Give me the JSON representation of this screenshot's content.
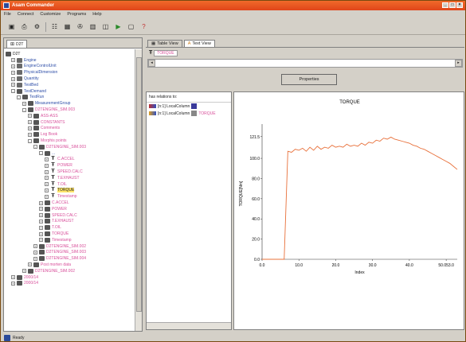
{
  "window": {
    "title": "Asam Commander"
  },
  "menu": [
    "File",
    "Connect",
    "Customize",
    "Programs",
    "Help"
  ],
  "toolbar": [
    "save-icon",
    "print-icon",
    "settings-icon",
    "tree-icon",
    "table-icon",
    "tools-icon",
    "book-icon",
    "window-icon",
    "play-icon",
    "page-icon",
    "help-icon"
  ],
  "left": {
    "tab_label": "D2T",
    "tree": [
      {
        "d": 0,
        "exp": "",
        "ico": "folder",
        "label": "D2T",
        "style": ""
      },
      {
        "d": 1,
        "exp": "+",
        "ico": "file",
        "label": "Engine",
        "style": "blue"
      },
      {
        "d": 1,
        "exp": "+",
        "ico": "file",
        "label": "EngineControlUnit",
        "style": "blue"
      },
      {
        "d": 1,
        "exp": "+",
        "ico": "file",
        "label": "PhysicalDimension",
        "style": "blue"
      },
      {
        "d": 1,
        "exp": "+",
        "ico": "file",
        "label": "Quantity",
        "style": "blue"
      },
      {
        "d": 1,
        "exp": "+",
        "ico": "file",
        "label": "TestBed",
        "style": "blue"
      },
      {
        "d": 1,
        "exp": "-",
        "ico": "folder",
        "label": "TestDemand",
        "style": "blue"
      },
      {
        "d": 2,
        "exp": "-",
        "ico": "folder",
        "label": "TestRun",
        "style": "blue"
      },
      {
        "d": 3,
        "exp": "+",
        "ico": "folder",
        "label": "MeasurementGroup",
        "style": "blue"
      },
      {
        "d": 3,
        "exp": "-",
        "ico": "folder",
        "label": "D2TENGINE_SIM.003",
        "style": "pink"
      },
      {
        "d": 4,
        "exp": "+",
        "ico": "folder",
        "label": "ASS-ASS",
        "style": "pink"
      },
      {
        "d": 4,
        "exp": "+",
        "ico": "folder",
        "label": "CONSTANTS",
        "style": "pink"
      },
      {
        "d": 4,
        "exp": "+",
        "ico": "folder",
        "label": "Comments",
        "style": "pink"
      },
      {
        "d": 4,
        "exp": "+",
        "ico": "folder",
        "label": "Log Book",
        "style": "pink"
      },
      {
        "d": 4,
        "exp": "-",
        "ico": "folder",
        "label": "Morphis points",
        "style": "pink"
      },
      {
        "d": 5,
        "exp": "-",
        "ico": "folder",
        "label": "D2TENGINE_SIM.003",
        "style": "pink"
      },
      {
        "d": 6,
        "exp": "-",
        "ico": "folder",
        "label": "...",
        "style": "blue"
      },
      {
        "d": 7,
        "exp": "+",
        "ico": "t",
        "label": "C.ACCEL",
        "style": "pink"
      },
      {
        "d": 7,
        "exp": "+",
        "ico": "t",
        "label": "POWER",
        "style": "pink"
      },
      {
        "d": 7,
        "exp": "+",
        "ico": "t",
        "label": "SPEED.CALC",
        "style": "pink"
      },
      {
        "d": 7,
        "exp": "+",
        "ico": "t",
        "label": "T.EXHAUST",
        "style": "pink"
      },
      {
        "d": 7,
        "exp": "+",
        "ico": "t",
        "label": "T.OIL",
        "style": "pink"
      },
      {
        "d": 7,
        "exp": "+",
        "ico": "t",
        "label": "TORQUE",
        "style": "hl"
      },
      {
        "d": 7,
        "exp": "+",
        "ico": "t",
        "label": "Timestamp",
        "style": "pink"
      },
      {
        "d": 6,
        "exp": "+",
        "ico": "folder",
        "label": "C.ACCEL",
        "style": "pink"
      },
      {
        "d": 6,
        "exp": "+",
        "ico": "folder",
        "label": "POWER",
        "style": "pink"
      },
      {
        "d": 6,
        "exp": "+",
        "ico": "folder",
        "label": "SPEED.CALC",
        "style": "pink"
      },
      {
        "d": 6,
        "exp": "+",
        "ico": "folder",
        "label": "T.EXHAUST",
        "style": "pink"
      },
      {
        "d": 6,
        "exp": "+",
        "ico": "folder",
        "label": "T.OIL",
        "style": "pink"
      },
      {
        "d": 6,
        "exp": "+",
        "ico": "folder",
        "label": "TORQUE",
        "style": "pink"
      },
      {
        "d": 6,
        "exp": "+",
        "ico": "folder",
        "label": "Timestamp",
        "style": "pink"
      },
      {
        "d": 5,
        "exp": "+",
        "ico": "folder",
        "label": "D2TENGINE_SIM.002",
        "style": "pink"
      },
      {
        "d": 5,
        "exp": "+",
        "ico": "folder",
        "label": "D2TENGINE_SIM.003",
        "style": "pink"
      },
      {
        "d": 5,
        "exp": "+",
        "ico": "folder",
        "label": "D2TENGINE_SIM.004",
        "style": "pink"
      },
      {
        "d": 4,
        "exp": "+",
        "ico": "folder",
        "label": "Post morten data",
        "style": "pink"
      },
      {
        "d": 3,
        "exp": "+",
        "ico": "folder",
        "label": "D2TENGINE_SIM.002",
        "style": "pink"
      },
      {
        "d": 1,
        "exp": "+",
        "ico": "folder",
        "label": "2000/14",
        "style": "pink"
      },
      {
        "d": 1,
        "exp": "+",
        "ico": "folder",
        "label": "2000/14",
        "style": "pink"
      }
    ]
  },
  "right": {
    "tabs": [
      {
        "label": "Table View",
        "active": false
      },
      {
        "label": "Text View",
        "active": true
      }
    ],
    "subtitle": "TORQUE",
    "properties_label": "Properties",
    "relations_header": "has relations to:",
    "relations": [
      {
        "label": "[n:1] LocalColumn",
        "extra": ""
      },
      {
        "label": "[n:1] LocalColumn",
        "extra": "TORQUE"
      }
    ]
  },
  "chart_data": {
    "type": "line",
    "title": "TORQUE",
    "xlabel": "Index",
    "ylabel": "TORQUE[Nm]",
    "xlim": [
      0,
      53
    ],
    "ylim": [
      0,
      130
    ],
    "xticks": [
      "0.0",
      "10.0",
      "20.0",
      "30.0",
      "40.0",
      "50.053.0"
    ],
    "yticks": [
      "0.0",
      "20.0",
      "40.0",
      "60.0",
      "80.0",
      "100.0",
      "121.5"
    ],
    "color": "#e8703a",
    "x": [
      0,
      1,
      2,
      3,
      4,
      5,
      6,
      7,
      8,
      9,
      10,
      11,
      12,
      13,
      14,
      15,
      16,
      17,
      18,
      19,
      20,
      21,
      22,
      23,
      24,
      25,
      26,
      27,
      28,
      29,
      30,
      31,
      32,
      33,
      34,
      35,
      36,
      37,
      38,
      39,
      40,
      41,
      42,
      43,
      44,
      45,
      46,
      47,
      48,
      49,
      50,
      51,
      52,
      53
    ],
    "values": [
      0,
      0,
      0,
      0,
      0,
      0,
      0,
      107,
      106,
      109,
      108,
      110,
      107,
      111,
      108,
      112,
      109,
      111,
      110,
      113,
      111,
      112,
      111,
      114,
      112,
      113,
      112,
      115,
      113,
      116,
      115,
      118,
      117,
      120,
      119,
      121,
      119,
      118,
      117,
      116,
      115,
      113,
      112,
      110,
      109,
      107,
      105,
      103,
      101,
      99,
      97,
      95,
      92,
      89
    ]
  },
  "status": {
    "text": "Ready"
  }
}
